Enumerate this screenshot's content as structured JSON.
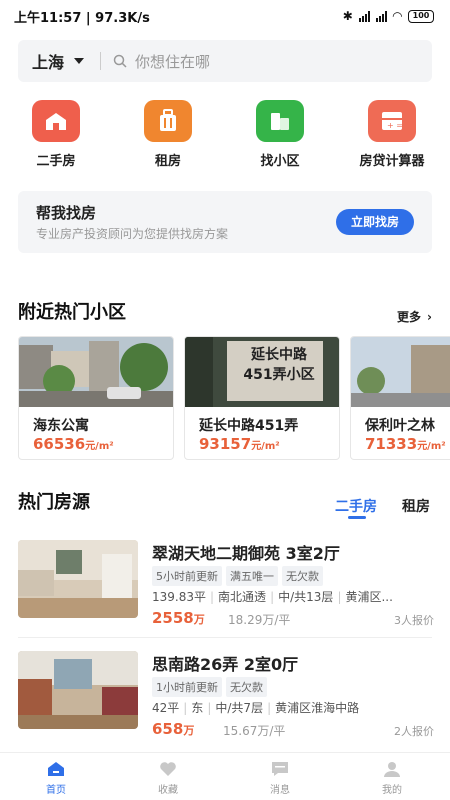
{
  "status_bar": {
    "time_speed": "上午11:57 | 97.3K/s",
    "battery": "100"
  },
  "search": {
    "city": "上海",
    "placeholder": "你想住在哪"
  },
  "quick_entries": [
    {
      "label": "二手房",
      "icon": "house-icon",
      "color": "#ef5f4c"
    },
    {
      "label": "租房",
      "icon": "suitcase-icon",
      "color": "#f0862f"
    },
    {
      "label": "找小区",
      "icon": "building-icon",
      "color": "#35b449"
    },
    {
      "label": "房贷计算器",
      "icon": "calculator-icon",
      "color": "#ef6b55"
    }
  ],
  "help_card": {
    "title": "帮我找房",
    "subtitle": "专业房产投资顾问为您提供找房方案",
    "button": "立即找房"
  },
  "nearby": {
    "title": "附近热门小区",
    "more": "更多",
    "cards": [
      {
        "name": "海东公寓",
        "price": "66536",
        "unit": "元/m²"
      },
      {
        "name": "延长中路451弄",
        "price": "93157",
        "unit": "元/m²",
        "sign": "延长中路 451弄小区"
      },
      {
        "name": "保利叶之林",
        "price": "71333",
        "unit": "元/m²"
      }
    ]
  },
  "hot": {
    "title": "热门房源",
    "tabs": [
      "二手房",
      "租房"
    ],
    "active_tab": 0,
    "listings": [
      {
        "title": "翠湖天地二期御苑 3室2厅",
        "tags": [
          "5小时前更新",
          "满五唯一",
          "无欠款"
        ],
        "info": [
          "139.83平",
          "南北通透",
          "中/共13层",
          "黄浦区..."
        ],
        "price": "2558",
        "price_unit": "万",
        "unit_price": "18.29万/平",
        "offers": "3人报价"
      },
      {
        "title": "思南路26弄 2室0厅",
        "tags": [
          "1小时前更新",
          "无欠款"
        ],
        "info": [
          "42平",
          "东",
          "中/共7层",
          "黄浦区淮海中路"
        ],
        "price": "658",
        "price_unit": "万",
        "unit_price": "15.67万/平",
        "offers": "2人报价"
      }
    ]
  },
  "bottom_nav": [
    {
      "label": "首页",
      "icon": "home-icon",
      "active": true
    },
    {
      "label": "收藏",
      "icon": "heart-icon",
      "active": false
    },
    {
      "label": "消息",
      "icon": "message-icon",
      "active": false
    },
    {
      "label": "我的",
      "icon": "user-icon",
      "active": false
    }
  ],
  "colors": {
    "accent": "#2f6fe8",
    "price": "#e8613a"
  }
}
